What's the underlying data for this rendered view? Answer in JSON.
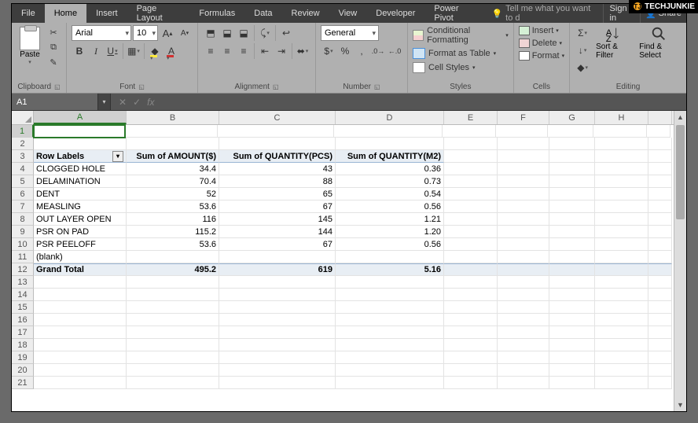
{
  "logo": {
    "brand": "TECHJUNKIE",
    "tj": "TJ"
  },
  "tabs": {
    "file": "File",
    "home": "Home",
    "insert": "Insert",
    "pageLayout": "Page Layout",
    "formulas": "Formulas",
    "data": "Data",
    "review": "Review",
    "view": "View",
    "developer": "Developer",
    "powerPivot": "Power Pivot"
  },
  "tellme": "Tell me what you want to d",
  "signin": "Sign in",
  "share": "Share",
  "ribbon": {
    "clipboard": {
      "label": "Clipboard",
      "paste": "Paste"
    },
    "font": {
      "label": "Font",
      "name": "Arial",
      "size": "10",
      "B": "B",
      "I": "I",
      "U": "U",
      "A_inc": "A",
      "A_dec": "A",
      "A": "A"
    },
    "alignment": {
      "label": "Alignment"
    },
    "number": {
      "label": "Number",
      "format": "General",
      "dollar": "$",
      "percent": "%",
      "comma": ","
    },
    "styles": {
      "label": "Styles",
      "cond": "Conditional Formatting",
      "table": "Format as Table",
      "cell": "Cell Styles"
    },
    "cells": {
      "label": "Cells",
      "insert": "Insert",
      "delete": "Delete",
      "format": "Format"
    },
    "editing": {
      "label": "Editing",
      "sort": "Sort & Filter",
      "find": "Find & Select",
      "sigma": "Σ",
      "fill": "↓",
      "clear": "◆"
    }
  },
  "namebox": "A1",
  "fx": "fx",
  "columns": [
    "A",
    "B",
    "C",
    "D",
    "E",
    "F",
    "G",
    "H"
  ],
  "rownums": [
    1,
    2,
    3,
    4,
    5,
    6,
    7,
    8,
    9,
    10,
    11,
    12,
    13,
    14,
    15,
    16,
    17,
    18,
    19,
    20,
    21
  ],
  "pivot": {
    "headers": {
      "rowlabels": "Row Labels",
      "amt": "Sum of AMOUNT($)",
      "qtypcs": "Sum of QUANTITY(PCS)",
      "qtym2": "Sum of QUANTITY(M2)"
    },
    "rows": [
      {
        "label": "CLOGGED HOLE",
        "amt": "34.4",
        "pcs": "43",
        "m2": "0.36"
      },
      {
        "label": "DELAMINATION",
        "amt": "70.4",
        "pcs": "88",
        "m2": "0.73"
      },
      {
        "label": "DENT",
        "amt": "52",
        "pcs": "65",
        "m2": "0.54"
      },
      {
        "label": "MEASLING",
        "amt": "53.6",
        "pcs": "67",
        "m2": "0.56"
      },
      {
        "label": "OUT LAYER OPEN",
        "amt": "116",
        "pcs": "145",
        "m2": "1.21"
      },
      {
        "label": "PSR ON PAD",
        "amt": "115.2",
        "pcs": "144",
        "m2": "1.20"
      },
      {
        "label": "PSR PEELOFF",
        "amt": "53.6",
        "pcs": "67",
        "m2": "0.56"
      }
    ],
    "blank": "(blank)",
    "total": {
      "label": "Grand Total",
      "amt": "495.2",
      "pcs": "619",
      "m2": "5.16"
    }
  }
}
